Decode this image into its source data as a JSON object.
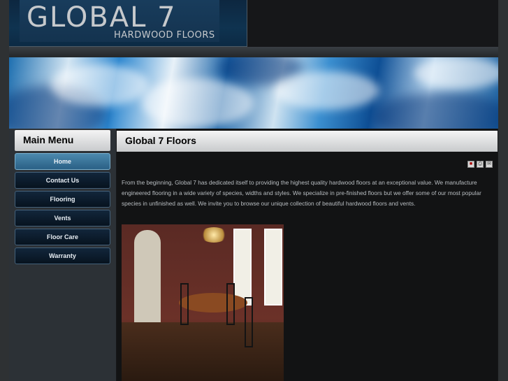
{
  "logo": {
    "title": "GLOBAL 7",
    "subtitle": "HARDWOOD FLOORS"
  },
  "sidebar": {
    "heading": "Main Menu",
    "items": [
      {
        "label": "Home",
        "active": true
      },
      {
        "label": "Contact Us"
      },
      {
        "label": "Flooring"
      },
      {
        "label": "Vents"
      },
      {
        "label": "Floor Care"
      },
      {
        "label": "Warranty"
      }
    ]
  },
  "main": {
    "title": "Global 7 Floors",
    "toolbar_icons": [
      "pdf-icon",
      "print-icon",
      "email-icon"
    ],
    "intro": "From the beginning, Global 7 has dedicated itself to providing the highest quality hardwood floors at an exceptional value.  We manufacture engineered flooring in a wide variety of species, widths and styles.  We specialize in pre-finished floors but we offer some of our most popular species in unfinished as well.  We invite you to browse our unique collection of beautiful hardwood floors and vents."
  },
  "colors": {
    "accent_active": "#3f7ba1",
    "background": "#161719",
    "text": "#b9bec2"
  }
}
